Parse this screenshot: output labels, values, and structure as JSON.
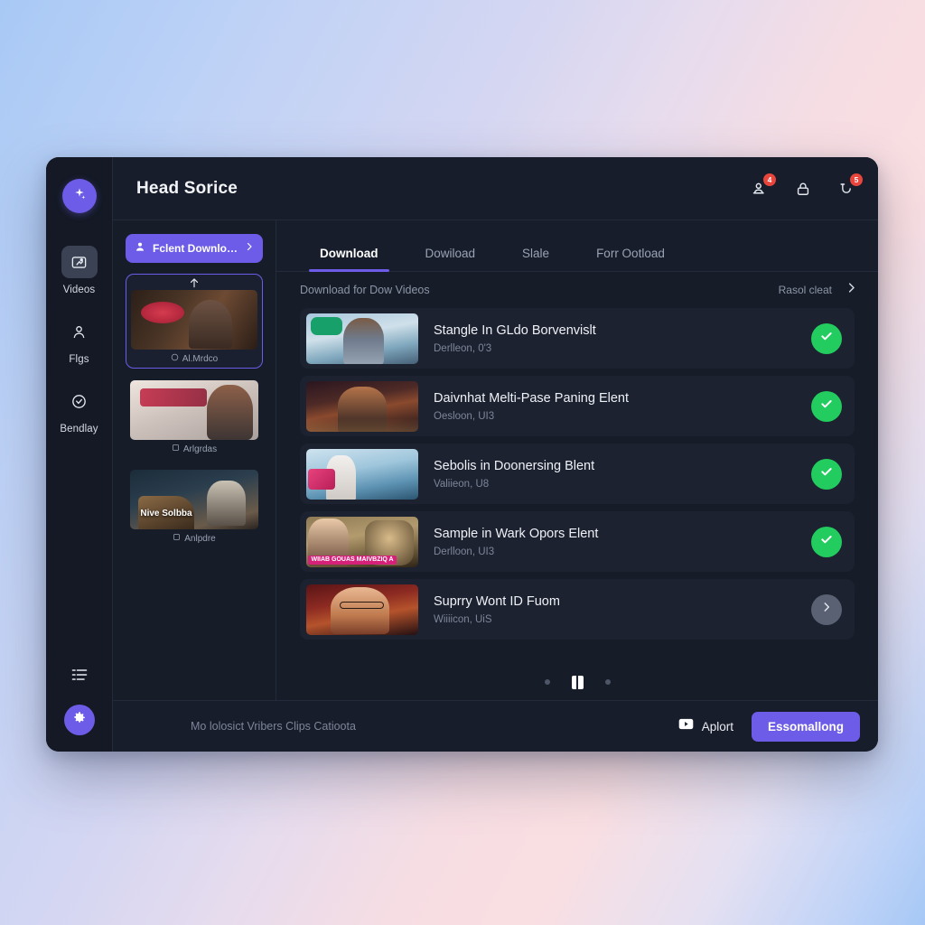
{
  "app": {
    "title": "Head Sorice"
  },
  "rail": {
    "brand_icon": "sparkle-icon",
    "items": [
      {
        "label": "Videos",
        "icon": "video-upload-icon",
        "active": true
      },
      {
        "label": "Flgs",
        "icon": "person-icon",
        "active": false
      },
      {
        "label": "Bendlay",
        "icon": "clock-check-icon",
        "active": false
      }
    ],
    "bottom": [
      {
        "icon": "list-menu-icon"
      },
      {
        "icon": "gear-icon"
      }
    ]
  },
  "topbar": {
    "icons": [
      {
        "name": "contact-card-icon",
        "badge": "4"
      },
      {
        "name": "lock-icon",
        "badge": ""
      },
      {
        "name": "notification-bell-icon",
        "badge": "5"
      }
    ]
  },
  "left_panel": {
    "recent_button": {
      "label": "Fclent Download",
      "icon": "person-icon",
      "chevron": "chevron-right-icon"
    },
    "videos": [
      {
        "caption": "Al.Mrdco",
        "selected": true,
        "overlay": ""
      },
      {
        "caption": "Arlgrdas",
        "selected": false,
        "overlay": ""
      },
      {
        "caption": "Anlpdre",
        "selected": false,
        "overlay": "Nive Solbba"
      }
    ]
  },
  "tabs": [
    {
      "label": "Download",
      "active": true
    },
    {
      "label": "Dowiload",
      "active": false
    },
    {
      "label": "Slale",
      "active": false
    },
    {
      "label": "Forr Ootload",
      "active": false
    }
  ],
  "subbar": {
    "title": "Download for Dow Videos",
    "link": "Rasol cleat",
    "chevron": "chevron-right-icon"
  },
  "rows": [
    {
      "title": "Stangle In GLdo Borvenvislt",
      "sub": "Derlleon, 0'3",
      "action": "done"
    },
    {
      "title": "Daivnhat Melti-Pase Paning Elent",
      "sub": "Oesloon, UI3",
      "action": "done"
    },
    {
      "title": "Sebolis in Doonersing Blent",
      "sub": "Valiieon, U8",
      "action": "done"
    },
    {
      "title": "Sample in Wark Opors Elent",
      "sub": "Derlloon, UI3",
      "action": "done",
      "overlay": "WIIAB GOUAS MAIVBZIQ A"
    },
    {
      "title": "Suprry Wont ID Fuom",
      "sub": "Wiiiicon, UiS",
      "action": "next"
    }
  ],
  "pager": {
    "dots": 3,
    "active_index": 1
  },
  "footer": {
    "note": "Mo lolosict Vribers Clips Catioota",
    "youtube_label": "Aplort",
    "youtube_icon": "youtube-icon",
    "cta_label": "Essomallong"
  },
  "colors": {
    "accent": "#6c5ce7",
    "success": "#22cc5e",
    "badge": "#e8453c",
    "window_bg": "#161b26",
    "panel_bg": "#171d2a",
    "row_bg": "#1c2230"
  }
}
